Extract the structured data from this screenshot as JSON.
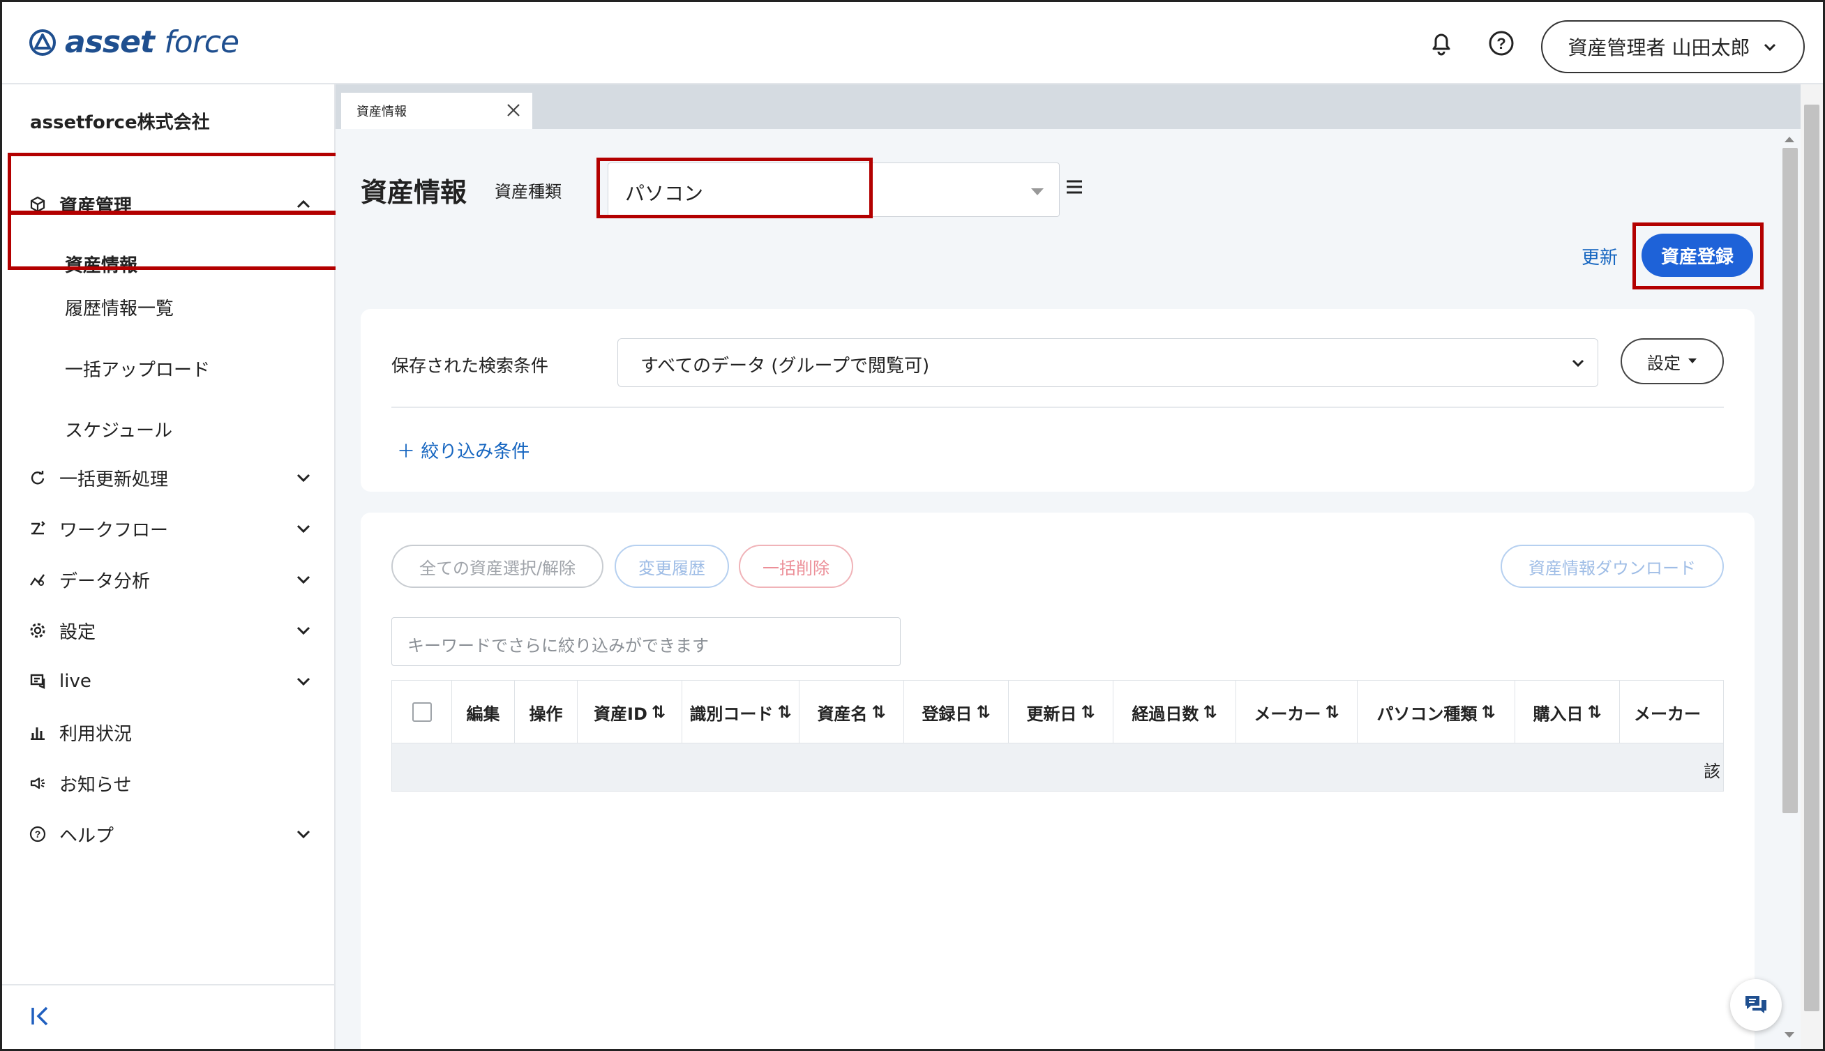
{
  "header": {
    "logo_prefix": "asset",
    "logo_suffix": "force",
    "user_label": "資産管理者 山田太郎"
  },
  "sidebar": {
    "company": "assetforce株式会社",
    "asset_mgmt": "資産管理",
    "sub_items": [
      "資産情報",
      "履歴情報一覧",
      "一括アップロード",
      "スケジュール"
    ],
    "items": [
      "一括更新処理",
      "ワークフロー",
      "データ分析",
      "設定",
      "live",
      "利用状況",
      "お知らせ",
      "ヘルプ"
    ]
  },
  "tab": {
    "label": "資産情報"
  },
  "page": {
    "title": "資産情報",
    "asset_type_label": "資産種類",
    "asset_type_value": "パソコン",
    "update_link": "更新",
    "register_button": "資産登録"
  },
  "search": {
    "label": "保存された検索条件",
    "value": "すべてのデータ (グループで閲覧可)",
    "settings_button": "設定",
    "filter_link": "＋ 絞り込み条件"
  },
  "actions": {
    "select_all": "全ての資産選択/解除",
    "history": "変更履歴",
    "bulk_delete": "一括削除",
    "download": "資産情報ダウンロード"
  },
  "keyword": {
    "placeholder": "キーワードでさらに絞り込みができます"
  },
  "table": {
    "columns": [
      "編集",
      "操作",
      "資産ID",
      "識別コード",
      "資産名",
      "登録日",
      "更新日",
      "経過日数",
      "メーカー",
      "パソコン種類",
      "購入日",
      "メーカー"
    ],
    "empty_text": "該"
  },
  "colors": {
    "accent": "#1e62d8",
    "highlight": "#b30000",
    "brand": "#1f4f8f"
  }
}
